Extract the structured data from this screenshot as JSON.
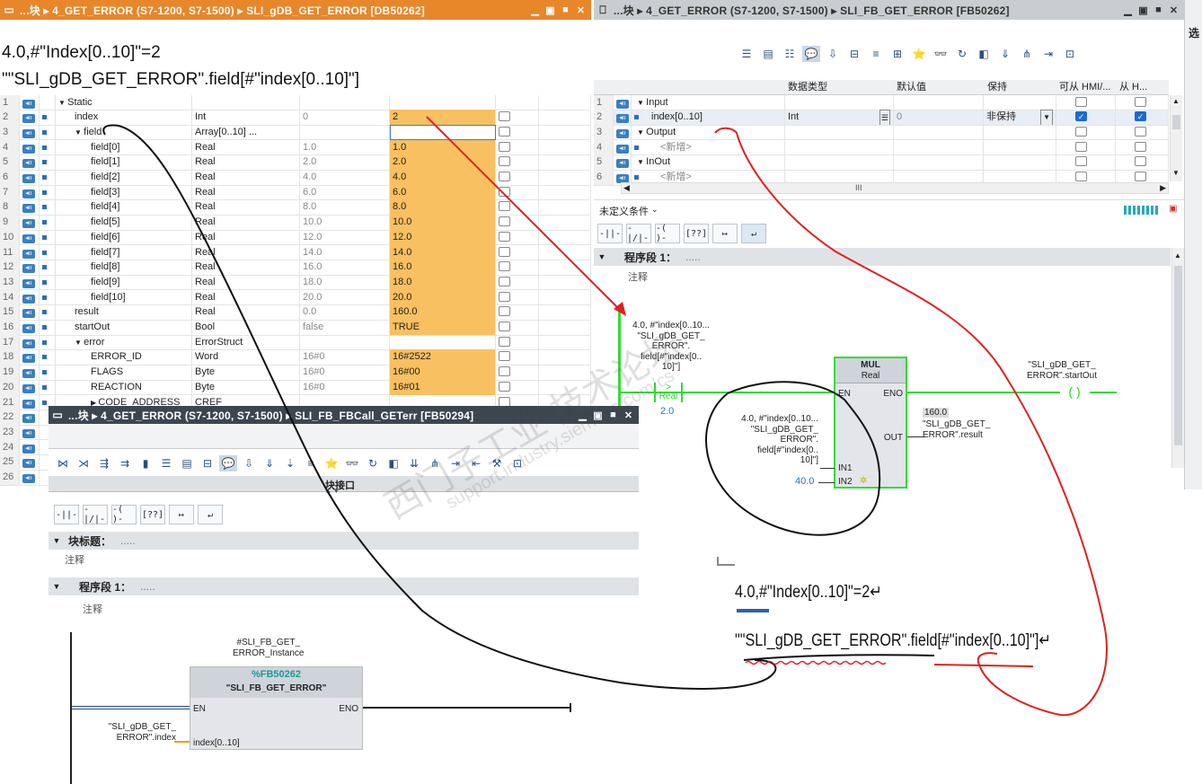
{
  "annotation_top": {
    "line1": "4.0,#\"Index[0..10]\"=2",
    "line2": "\"\"SLI_gDB_GET_ERROR\".field[#\"index[0..10]\"]"
  },
  "annotation_bottom": {
    "line1": "4.0,#\"Index[0..10]\"=2↵",
    "line2": "\"\"SLI_gDB_GET_ERROR\".field[#\"index[0..10]\"]↵"
  },
  "watermark": {
    "cn": "西门子工业 技术论坛",
    "url": "support.industry.siemens.com/cs"
  },
  "db_window": {
    "title": "...块 ▸ 4_GET_ERROR (S7-1200, S7-1500) ▸ SLI_gDB_GET_ERROR [DB50262]",
    "rows": [
      {
        "n": "1",
        "icon": true,
        "dot": false,
        "expand": "▼",
        "name": "Static",
        "type": "",
        "start": "",
        "monitor": "",
        "indent": 0
      },
      {
        "n": "2",
        "icon": true,
        "dot": true,
        "expand": "",
        "name": "index",
        "type": "Int",
        "start": "0",
        "monitor": "2",
        "indent": 1
      },
      {
        "n": "3",
        "icon": true,
        "dot": true,
        "expand": "▼",
        "name": "field",
        "type": "Array[0..10] ...",
        "start": "",
        "monitor": "",
        "indent": 1
      },
      {
        "n": "4",
        "icon": true,
        "dot": true,
        "expand": "",
        "name": "field[0]",
        "type": "Real",
        "start": "1.0",
        "monitor": "1.0",
        "indent": 2
      },
      {
        "n": "5",
        "icon": true,
        "dot": true,
        "expand": "",
        "name": "field[1]",
        "type": "Real",
        "start": "2.0",
        "monitor": "2.0",
        "indent": 2
      },
      {
        "n": "6",
        "icon": true,
        "dot": true,
        "expand": "",
        "name": "field[2]",
        "type": "Real",
        "start": "4.0",
        "monitor": "4.0",
        "indent": 2
      },
      {
        "n": "7",
        "icon": true,
        "dot": true,
        "expand": "",
        "name": "field[3]",
        "type": "Real",
        "start": "6.0",
        "monitor": "6.0",
        "indent": 2
      },
      {
        "n": "8",
        "icon": true,
        "dot": true,
        "expand": "",
        "name": "field[4]",
        "type": "Real",
        "start": "8.0",
        "monitor": "8.0",
        "indent": 2
      },
      {
        "n": "9",
        "icon": true,
        "dot": true,
        "expand": "",
        "name": "field[5]",
        "type": "Real",
        "start": "10.0",
        "monitor": "10.0",
        "indent": 2
      },
      {
        "n": "10",
        "icon": true,
        "dot": true,
        "expand": "",
        "name": "field[6]",
        "type": "Real",
        "start": "12.0",
        "monitor": "12.0",
        "indent": 2
      },
      {
        "n": "11",
        "icon": true,
        "dot": true,
        "expand": "",
        "name": "field[7]",
        "type": "Real",
        "start": "14.0",
        "monitor": "14.0",
        "indent": 2
      },
      {
        "n": "12",
        "icon": true,
        "dot": true,
        "expand": "",
        "name": "field[8]",
        "type": "Real",
        "start": "16.0",
        "monitor": "16.0",
        "indent": 2
      },
      {
        "n": "13",
        "icon": true,
        "dot": true,
        "expand": "",
        "name": "field[9]",
        "type": "Real",
        "start": "18.0",
        "monitor": "18.0",
        "indent": 2
      },
      {
        "n": "14",
        "icon": true,
        "dot": true,
        "expand": "",
        "name": "field[10]",
        "type": "Real",
        "start": "20.0",
        "monitor": "20.0",
        "indent": 2
      },
      {
        "n": "15",
        "icon": true,
        "dot": true,
        "expand": "",
        "name": "result",
        "type": "Real",
        "start": "0.0",
        "monitor": "160.0",
        "indent": 1
      },
      {
        "n": "16",
        "icon": true,
        "dot": true,
        "expand": "",
        "name": "startOut",
        "type": "Bool",
        "start": "false",
        "monitor": "TRUE",
        "indent": 1
      },
      {
        "n": "17",
        "icon": true,
        "dot": true,
        "expand": "▼",
        "name": "error",
        "type": "ErrorStruct",
        "start": "",
        "monitor": "",
        "indent": 1
      },
      {
        "n": "18",
        "icon": true,
        "dot": true,
        "expand": "",
        "name": "ERROR_ID",
        "type": "Word",
        "start": "16#0",
        "monitor": "16#2522",
        "indent": 2
      },
      {
        "n": "19",
        "icon": true,
        "dot": true,
        "expand": "",
        "name": "FLAGS",
        "type": "Byte",
        "start": "16#0",
        "monitor": "16#00",
        "indent": 2
      },
      {
        "n": "20",
        "icon": true,
        "dot": true,
        "expand": "",
        "name": "REACTION",
        "type": "Byte",
        "start": "16#0",
        "monitor": "16#01",
        "indent": 2
      },
      {
        "n": "21",
        "icon": true,
        "dot": true,
        "expand": "▶",
        "name": "CODE_ADDRESS",
        "type": "CREF",
        "start": "",
        "monitor": "",
        "indent": 2
      },
      {
        "n": "22",
        "icon": true,
        "dot": false,
        "expand": "",
        "name": "",
        "type": "",
        "start": "",
        "monitor": "",
        "indent": 0
      },
      {
        "n": "23",
        "icon": true,
        "dot": false,
        "expand": "",
        "name": "",
        "type": "",
        "start": "",
        "monitor": "",
        "indent": 0
      },
      {
        "n": "24",
        "icon": true,
        "dot": false,
        "expand": "",
        "name": "",
        "type": "",
        "start": "",
        "monitor": "",
        "indent": 0
      },
      {
        "n": "25",
        "icon": true,
        "dot": false,
        "expand": "",
        "name": "",
        "type": "",
        "start": "",
        "monitor": "",
        "indent": 0
      },
      {
        "n": "26",
        "icon": true,
        "dot": false,
        "expand": "",
        "name": "",
        "type": "",
        "start": "",
        "monitor": "",
        "indent": 0
      }
    ]
  },
  "fb_window": {
    "title": "...块 ▸ 4_GET_ERROR (S7-1200, S7-1500) ▸ SLI_FB_GET_ERROR [FB50262]",
    "side_label": "选",
    "iface_headers": {
      "datatype": "数据类型",
      "default": "默认值",
      "retain": "保持",
      "hmi": "可从 HMI/...",
      "from_h": "从 H..."
    },
    "iface_rows": [
      {
        "n": "1",
        "expand": "▼",
        "name": "Input",
        "type": "",
        "default": "",
        "retain": "",
        "hmi": false,
        "from": false,
        "sub": false
      },
      {
        "n": "2",
        "expand": "",
        "name": "index[0..10]",
        "type": "Int",
        "default": "0",
        "retain": "非保持",
        "hmi": true,
        "from": true,
        "sub": true
      },
      {
        "n": "3",
        "expand": "▼",
        "name": "Output",
        "type": "",
        "default": "",
        "retain": "",
        "hmi": false,
        "from": false,
        "sub": false
      },
      {
        "n": "4",
        "expand": "",
        "name": "<新增>",
        "type": "",
        "default": "",
        "retain": "",
        "hmi": false,
        "from": false,
        "sub": true
      },
      {
        "n": "5",
        "expand": "▼",
        "name": "InOut",
        "type": "",
        "default": "",
        "retain": "",
        "hmi": false,
        "from": false,
        "sub": false
      },
      {
        "n": "6",
        "expand": "",
        "name": "<新增>",
        "type": "",
        "default": "",
        "retain": "",
        "hmi": false,
        "from": false,
        "sub": true
      }
    ],
    "hscroll": "III",
    "favorites": "未定义条件",
    "segment_title": "程序段 1：",
    "segment_dots": ".....",
    "segment_comment": "注释",
    "contact_label": "4.0, #\"index[0..10...\n\"SLI_gDB_GET_\nERROR\".\nfield[#\"index[0..\n10]\"]",
    "contact_type": "Real",
    "contact_op": ">",
    "contact_value": "2.0",
    "mul_title": "MUL",
    "mul_type": "Real",
    "pin_en": "EN",
    "pin_eno": "ENO",
    "pin_out": "OUT",
    "pin_in1": "IN1",
    "pin_in2": "IN2",
    "in1_label": "4.0, #\"index[0..10...\n\"SLI_gDB_GET_\nERROR\".\nfield[#\"index[0..\n10]\"]",
    "in2_value": "40.0",
    "out_value": "160.0",
    "out_label": "\"SLI_gDB_GET_\nERROR\".result",
    "coil_label": "\"SLI_gDB_GET_\nERROR\".startOut"
  },
  "call_window": {
    "title": "...块 ▸ 4_GET_ERROR (S7-1200, S7-1500) ▸ SLI_FB_FBCall_GETerr [FB50294]",
    "iface_label": "块接口",
    "block_title_label": "块标题：",
    "block_dots": ".....",
    "block_comment": "注释",
    "segment_title": "程序段 1：",
    "segment_dots": ".....",
    "segment_comment": "注释",
    "instance_label": "#SLI_FB_GET_\nERROR_Instance",
    "fb_number": "%FB50262",
    "fb_name": "\"SLI_FB_GET_ERROR\"",
    "pin_en": "EN",
    "pin_eno": "ENO",
    "pin_index": "index[0..10]",
    "index_actual": "\"SLI_gDB_GET_\nERROR\".index"
  },
  "colors": {
    "titlebar_db": "#e8862a",
    "titlebar_call": "#3b4651",
    "monitor_cell": "#f8c060",
    "powerflow": "#33dd33",
    "annotation_red": "#e02020"
  }
}
